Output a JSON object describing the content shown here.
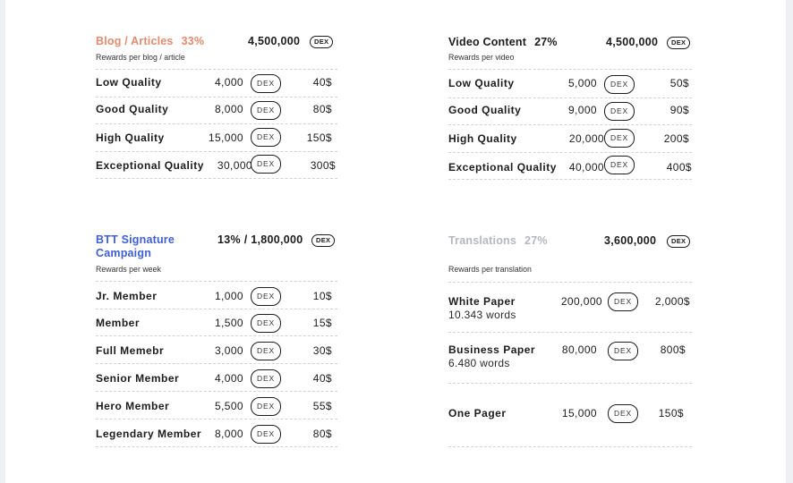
{
  "colors": {
    "blog_title": "#e28b6e",
    "btt_title": "#3f5fd6",
    "translations_title": "#b3b8bf",
    "text": "#1c1c1c"
  },
  "blog": {
    "title": "Blog / Articles",
    "percent": "33%",
    "total": "4,500,000",
    "token": "DEX",
    "subtitle": "Rewards per blog / article",
    "rows": [
      {
        "label": "Low Quality",
        "amount": "4,000",
        "token": "DEX",
        "usd": "40$"
      },
      {
        "label": "Good Quality",
        "amount": "8,000",
        "token": "DEX",
        "usd": "80$"
      },
      {
        "label": "High Quality",
        "amount": "15,000",
        "token": "DEX",
        "usd": "150$"
      },
      {
        "label": "Exceptional Quality",
        "amount": "30,000",
        "token": "DEX",
        "usd": "300$"
      }
    ]
  },
  "video": {
    "title": "Video Content",
    "percent": "27%",
    "total": "4,500,000",
    "token": "DEX",
    "subtitle": "Rewards per video",
    "rows": [
      {
        "label": "Low Quality",
        "amount": "5,000",
        "token": "DEX",
        "usd": "50$"
      },
      {
        "label": "Good Quality",
        "amount": "9,000",
        "token": "DEX",
        "usd": "90$"
      },
      {
        "label": "High Quality",
        "amount": "20,000",
        "token": "DEX",
        "usd": "200$"
      },
      {
        "label": "Exceptional Quality",
        "amount": "40,000",
        "token": "DEX",
        "usd": "400$"
      }
    ]
  },
  "btt": {
    "title_line1": "BTT Signature",
    "title_line2": "Campaign",
    "total": "13% / 1,800,000",
    "token": "DEX",
    "subtitle": "Rewards per week",
    "rows": [
      {
        "label": "Jr. Member",
        "amount": "1,000",
        "token": "DEX",
        "usd": "10$"
      },
      {
        "label": "Member",
        "amount": "1,500",
        "token": "DEX",
        "usd": "15$"
      },
      {
        "label": "Full Memebr",
        "amount": "3,000",
        "token": "DEX",
        "usd": "30$"
      },
      {
        "label": "Senior Member",
        "amount": "4,000",
        "token": "DEX",
        "usd": "40$"
      },
      {
        "label": "Hero Member",
        "amount": "5,500",
        "token": "DEX",
        "usd": "55$"
      },
      {
        "label": "Legendary Member",
        "amount": "8,000",
        "token": "DEX",
        "usd": "80$"
      }
    ]
  },
  "translations": {
    "title": "Translations",
    "percent": "27%",
    "total": "3,600,000",
    "token": "DEX",
    "subtitle": "Rewards per translation",
    "rows": [
      {
        "label": "White Paper",
        "sublabel": "10.343 words",
        "amount": "200,000",
        "token": "DEX",
        "usd": "2,000$"
      },
      {
        "label": "Business Paper",
        "sublabel": "6.480 words",
        "amount": "80,000",
        "token": "DEX",
        "usd": "800$"
      },
      {
        "label": "One Pager",
        "amount": "15,000",
        "token": "DEX",
        "usd": "150$"
      }
    ]
  }
}
